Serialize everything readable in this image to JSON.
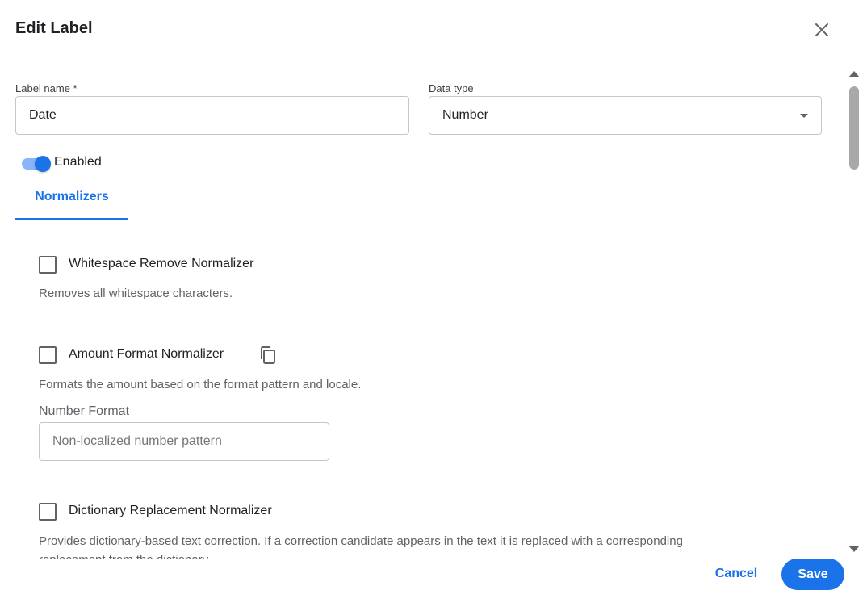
{
  "dialog": {
    "title": "Edit Label",
    "close_icon": "close-icon"
  },
  "form": {
    "label_name": {
      "label": "Label name *",
      "value": "Date"
    },
    "data_type": {
      "label": "Data type",
      "value": "Number",
      "icon": "chevron-down-icon"
    },
    "enabled": {
      "label": "Enabled",
      "checked": true
    }
  },
  "tabs": [
    {
      "label": "Normalizers",
      "active": true
    }
  ],
  "normalizers": [
    {
      "title": "Whitespace Remove Normalizer",
      "description": "Removes all whitespace characters.",
      "checked": false
    },
    {
      "title": "Amount Format Normalizer",
      "description": "Formats the amount based on the format pattern and locale.",
      "checked": false,
      "icon": "copy-icon",
      "field": {
        "label": "Number Format",
        "value": "",
        "placeholder": "Non-localized number pattern"
      }
    },
    {
      "title": "Dictionary Replacement Normalizer",
      "description": "Provides dictionary-based text correction. If a correction candidate appears in the text it is replaced with a corresponding replacement from the dictionary",
      "checked": false
    }
  ],
  "footer": {
    "cancel_label": "Cancel",
    "save_label": "Save"
  },
  "colors": {
    "accent": "#1a73e8",
    "toggle_track": "#8ab4f8",
    "text_primary": "#202124",
    "text_secondary": "#5f6368",
    "border": "#c4c7c5"
  }
}
